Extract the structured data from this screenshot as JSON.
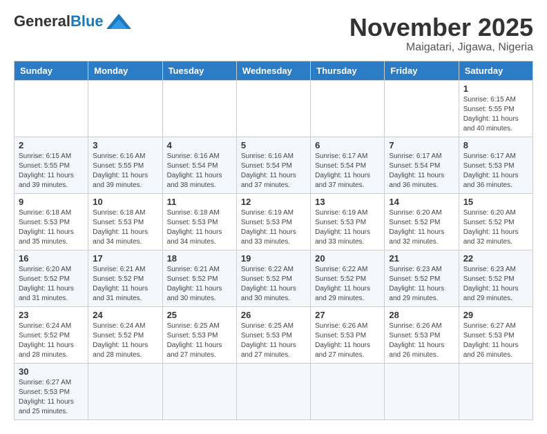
{
  "header": {
    "logo_general": "General",
    "logo_blue": "Blue",
    "month_title": "November 2025",
    "location": "Maigatari, Jigawa, Nigeria"
  },
  "weekdays": [
    "Sunday",
    "Monday",
    "Tuesday",
    "Wednesday",
    "Thursday",
    "Friday",
    "Saturday"
  ],
  "weeks": [
    [
      {
        "day": "",
        "info": ""
      },
      {
        "day": "",
        "info": ""
      },
      {
        "day": "",
        "info": ""
      },
      {
        "day": "",
        "info": ""
      },
      {
        "day": "",
        "info": ""
      },
      {
        "day": "",
        "info": ""
      },
      {
        "day": "1",
        "info": "Sunrise: 6:15 AM\nSunset: 5:55 PM\nDaylight: 11 hours\nand 40 minutes."
      }
    ],
    [
      {
        "day": "2",
        "info": "Sunrise: 6:15 AM\nSunset: 5:55 PM\nDaylight: 11 hours\nand 39 minutes."
      },
      {
        "day": "3",
        "info": "Sunrise: 6:16 AM\nSunset: 5:55 PM\nDaylight: 11 hours\nand 39 minutes."
      },
      {
        "day": "4",
        "info": "Sunrise: 6:16 AM\nSunset: 5:54 PM\nDaylight: 11 hours\nand 38 minutes."
      },
      {
        "day": "5",
        "info": "Sunrise: 6:16 AM\nSunset: 5:54 PM\nDaylight: 11 hours\nand 37 minutes."
      },
      {
        "day": "6",
        "info": "Sunrise: 6:17 AM\nSunset: 5:54 PM\nDaylight: 11 hours\nand 37 minutes."
      },
      {
        "day": "7",
        "info": "Sunrise: 6:17 AM\nSunset: 5:54 PM\nDaylight: 11 hours\nand 36 minutes."
      },
      {
        "day": "8",
        "info": "Sunrise: 6:17 AM\nSunset: 5:53 PM\nDaylight: 11 hours\nand 36 minutes."
      }
    ],
    [
      {
        "day": "9",
        "info": "Sunrise: 6:18 AM\nSunset: 5:53 PM\nDaylight: 11 hours\nand 35 minutes."
      },
      {
        "day": "10",
        "info": "Sunrise: 6:18 AM\nSunset: 5:53 PM\nDaylight: 11 hours\nand 34 minutes."
      },
      {
        "day": "11",
        "info": "Sunrise: 6:18 AM\nSunset: 5:53 PM\nDaylight: 11 hours\nand 34 minutes."
      },
      {
        "day": "12",
        "info": "Sunrise: 6:19 AM\nSunset: 5:53 PM\nDaylight: 11 hours\nand 33 minutes."
      },
      {
        "day": "13",
        "info": "Sunrise: 6:19 AM\nSunset: 5:53 PM\nDaylight: 11 hours\nand 33 minutes."
      },
      {
        "day": "14",
        "info": "Sunrise: 6:20 AM\nSunset: 5:52 PM\nDaylight: 11 hours\nand 32 minutes."
      },
      {
        "day": "15",
        "info": "Sunrise: 6:20 AM\nSunset: 5:52 PM\nDaylight: 11 hours\nand 32 minutes."
      }
    ],
    [
      {
        "day": "16",
        "info": "Sunrise: 6:20 AM\nSunset: 5:52 PM\nDaylight: 11 hours\nand 31 minutes."
      },
      {
        "day": "17",
        "info": "Sunrise: 6:21 AM\nSunset: 5:52 PM\nDaylight: 11 hours\nand 31 minutes."
      },
      {
        "day": "18",
        "info": "Sunrise: 6:21 AM\nSunset: 5:52 PM\nDaylight: 11 hours\nand 30 minutes."
      },
      {
        "day": "19",
        "info": "Sunrise: 6:22 AM\nSunset: 5:52 PM\nDaylight: 11 hours\nand 30 minutes."
      },
      {
        "day": "20",
        "info": "Sunrise: 6:22 AM\nSunset: 5:52 PM\nDaylight: 11 hours\nand 29 minutes."
      },
      {
        "day": "21",
        "info": "Sunrise: 6:23 AM\nSunset: 5:52 PM\nDaylight: 11 hours\nand 29 minutes."
      },
      {
        "day": "22",
        "info": "Sunrise: 6:23 AM\nSunset: 5:52 PM\nDaylight: 11 hours\nand 29 minutes."
      }
    ],
    [
      {
        "day": "23",
        "info": "Sunrise: 6:24 AM\nSunset: 5:52 PM\nDaylight: 11 hours\nand 28 minutes."
      },
      {
        "day": "24",
        "info": "Sunrise: 6:24 AM\nSunset: 5:52 PM\nDaylight: 11 hours\nand 28 minutes."
      },
      {
        "day": "25",
        "info": "Sunrise: 6:25 AM\nSunset: 5:53 PM\nDaylight: 11 hours\nand 27 minutes."
      },
      {
        "day": "26",
        "info": "Sunrise: 6:25 AM\nSunset: 5:53 PM\nDaylight: 11 hours\nand 27 minutes."
      },
      {
        "day": "27",
        "info": "Sunrise: 6:26 AM\nSunset: 5:53 PM\nDaylight: 11 hours\nand 27 minutes."
      },
      {
        "day": "28",
        "info": "Sunrise: 6:26 AM\nSunset: 5:53 PM\nDaylight: 11 hours\nand 26 minutes."
      },
      {
        "day": "29",
        "info": "Sunrise: 6:27 AM\nSunset: 5:53 PM\nDaylight: 11 hours\nand 26 minutes."
      }
    ],
    [
      {
        "day": "30",
        "info": "Sunrise: 6:27 AM\nSunset: 5:53 PM\nDaylight: 11 hours\nand 25 minutes."
      },
      {
        "day": "",
        "info": ""
      },
      {
        "day": "",
        "info": ""
      },
      {
        "day": "",
        "info": ""
      },
      {
        "day": "",
        "info": ""
      },
      {
        "day": "",
        "info": ""
      },
      {
        "day": "",
        "info": ""
      }
    ]
  ]
}
